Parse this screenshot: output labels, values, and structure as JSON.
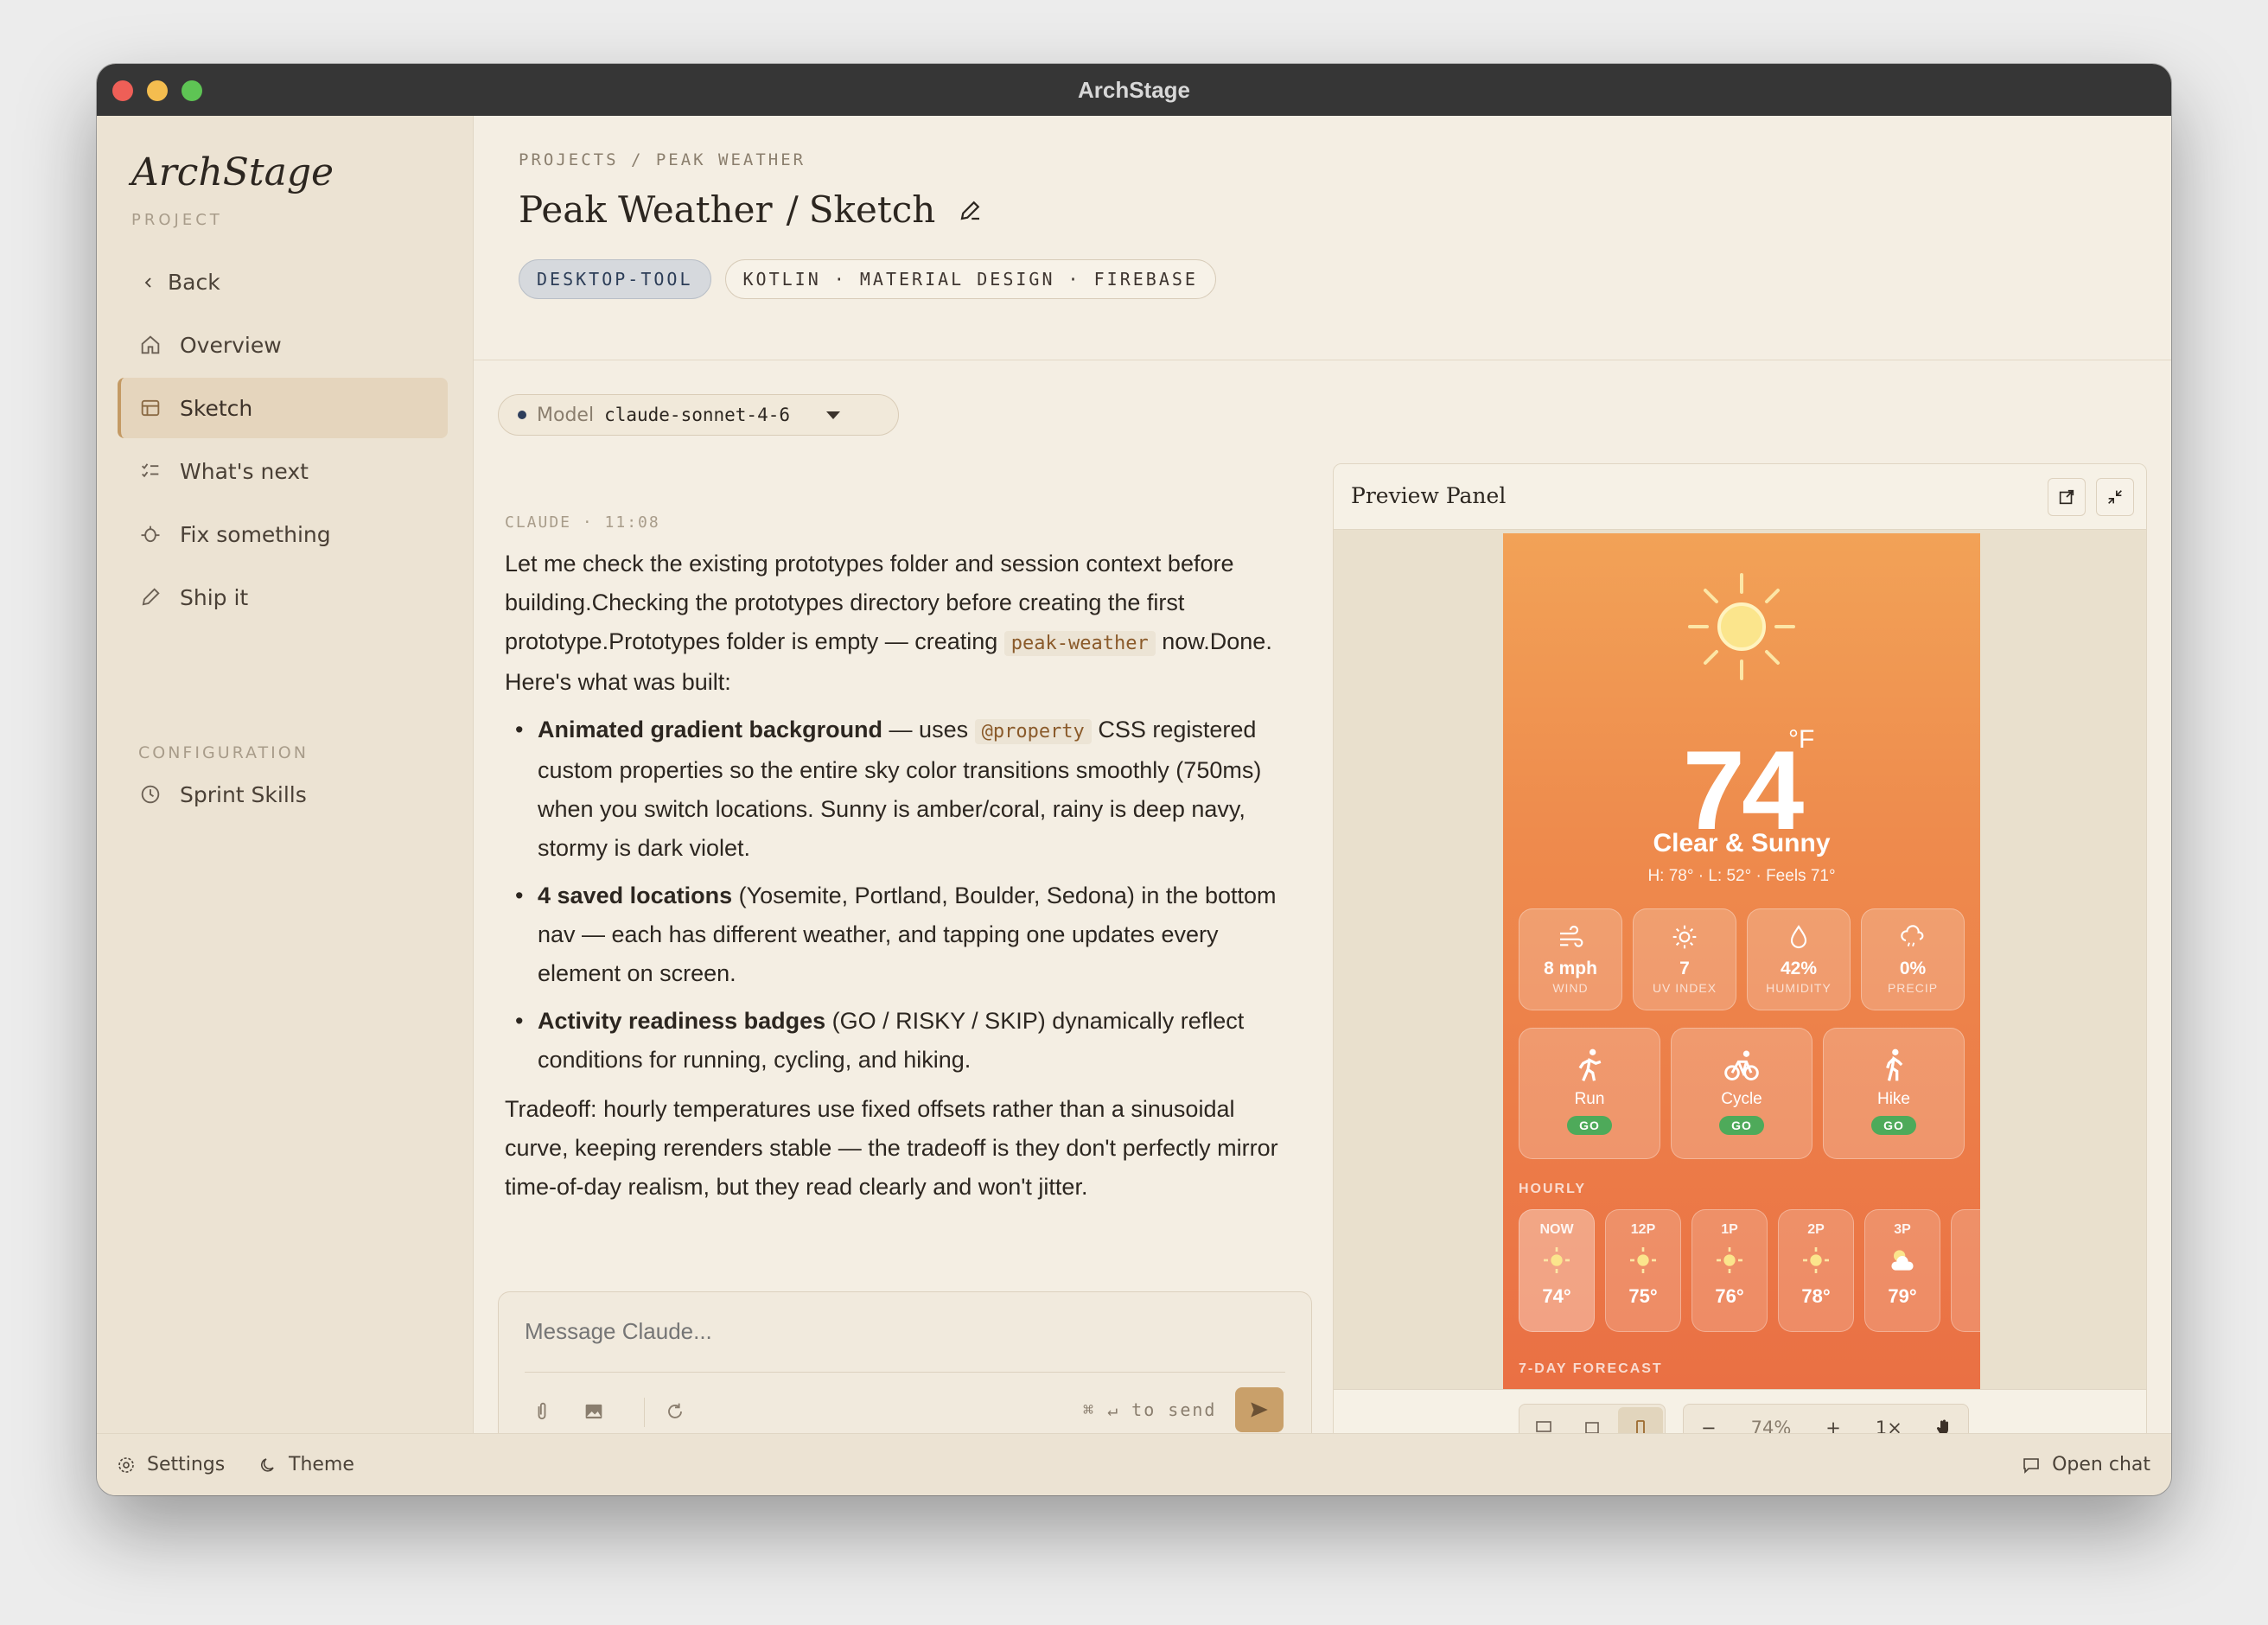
{
  "window": {
    "title": "ArchStage"
  },
  "sidebar": {
    "brand": "ArchStage",
    "brand_sub": "PROJECT",
    "back_label": "Back",
    "items": [
      {
        "label": "Overview",
        "icon": "home-icon"
      },
      {
        "label": "Sketch",
        "icon": "sketch-icon",
        "active": true
      },
      {
        "label": "What's next",
        "icon": "checklist-icon"
      },
      {
        "label": "Fix something",
        "icon": "bug-icon"
      },
      {
        "label": "Ship it",
        "icon": "pencil-icon"
      }
    ],
    "config_label": "CONFIGURATION",
    "config_items": [
      {
        "label": "Sprint Skills",
        "icon": "clock-icon"
      }
    ]
  },
  "footer": {
    "settings": "Settings",
    "theme": "Theme",
    "open_chat": "Open chat"
  },
  "header": {
    "breadcrumb": "PROJECTS / PEAK WEATHER",
    "project": "Peak Weather",
    "sep": "/",
    "mode": "Sketch",
    "tag_primary": "DESKTOP-TOOL",
    "tag_stack": "KOTLIN · MATERIAL DESIGN · FIREBASE"
  },
  "model": {
    "label": "Model",
    "value": "claude-sonnet-4-6"
  },
  "message": {
    "author": "CLAUDE",
    "time": "· 11:08",
    "intro_a": "Let me check the existing prototypes folder and session context before building.Checking the prototypes directory before creating the first prototype.Prototypes folder is empty — creating ",
    "intro_code": "peak-weather",
    "intro_b": " now.Done. Here's what was built:",
    "b1_bold": "Animated gradient background",
    "b1_a": " — uses ",
    "b1_code": "@property",
    "b1_b": " CSS registered custom properties so the entire sky color transitions smoothly (750ms) when you switch locations. Sunny is amber/coral, rainy is deep navy, stormy is dark violet.",
    "b2_bold": "4 saved locations",
    "b2_text": " (Yosemite, Portland, Boulder, Sedona) in the bottom nav — each has different weather, and tapping one updates every element on screen.",
    "b3_bold": "Activity readiness badges",
    "b3_text": " (GO / RISKY / SKIP) dynamically reflect conditions for running, cycling, and hiking.",
    "outro": "Tradeoff: hourly temperatures use fixed offsets rather than a sinusoidal curve, keeping rerenders stable — the tradeoff is they don't perfectly mirror time-of-day realism, but they read clearly and won't jitter."
  },
  "composer": {
    "placeholder": "Message Claude...",
    "hint": "⌘ ↵ to send"
  },
  "preview": {
    "title": "Preview Panel",
    "zoom": "74%",
    "zoom_minus": "−",
    "zoom_plus": "+",
    "scale": "1×",
    "weather": {
      "temp": "74",
      "unit": "°F",
      "condition": "Clear & Sunny",
      "hilo": "H: 78° · L: 52° · Feels 71°",
      "stats": [
        {
          "value": "8 mph",
          "label": "WIND",
          "icon": "wind-icon"
        },
        {
          "value": "7",
          "label": "UV INDEX",
          "icon": "sun-small-icon"
        },
        {
          "value": "42%",
          "label": "HUMIDITY",
          "icon": "droplet-icon"
        },
        {
          "value": "0%",
          "label": "PRECIP",
          "icon": "rain-cloud-icon"
        }
      ],
      "activities": [
        {
          "name": "Run",
          "badge": "GO",
          "icon": "run-icon"
        },
        {
          "name": "Cycle",
          "badge": "GO",
          "icon": "bike-icon"
        },
        {
          "name": "Hike",
          "badge": "GO",
          "icon": "hike-icon"
        }
      ],
      "hourly_label": "HOURLY",
      "hourly": [
        {
          "time": "NOW",
          "temp": "74°"
        },
        {
          "time": "12P",
          "temp": "75°"
        },
        {
          "time": "1P",
          "temp": "76°"
        },
        {
          "time": "2P",
          "temp": "78°"
        },
        {
          "time": "3P",
          "temp": "79°"
        }
      ],
      "forecast_label": "7-DAY FORECAST"
    }
  }
}
